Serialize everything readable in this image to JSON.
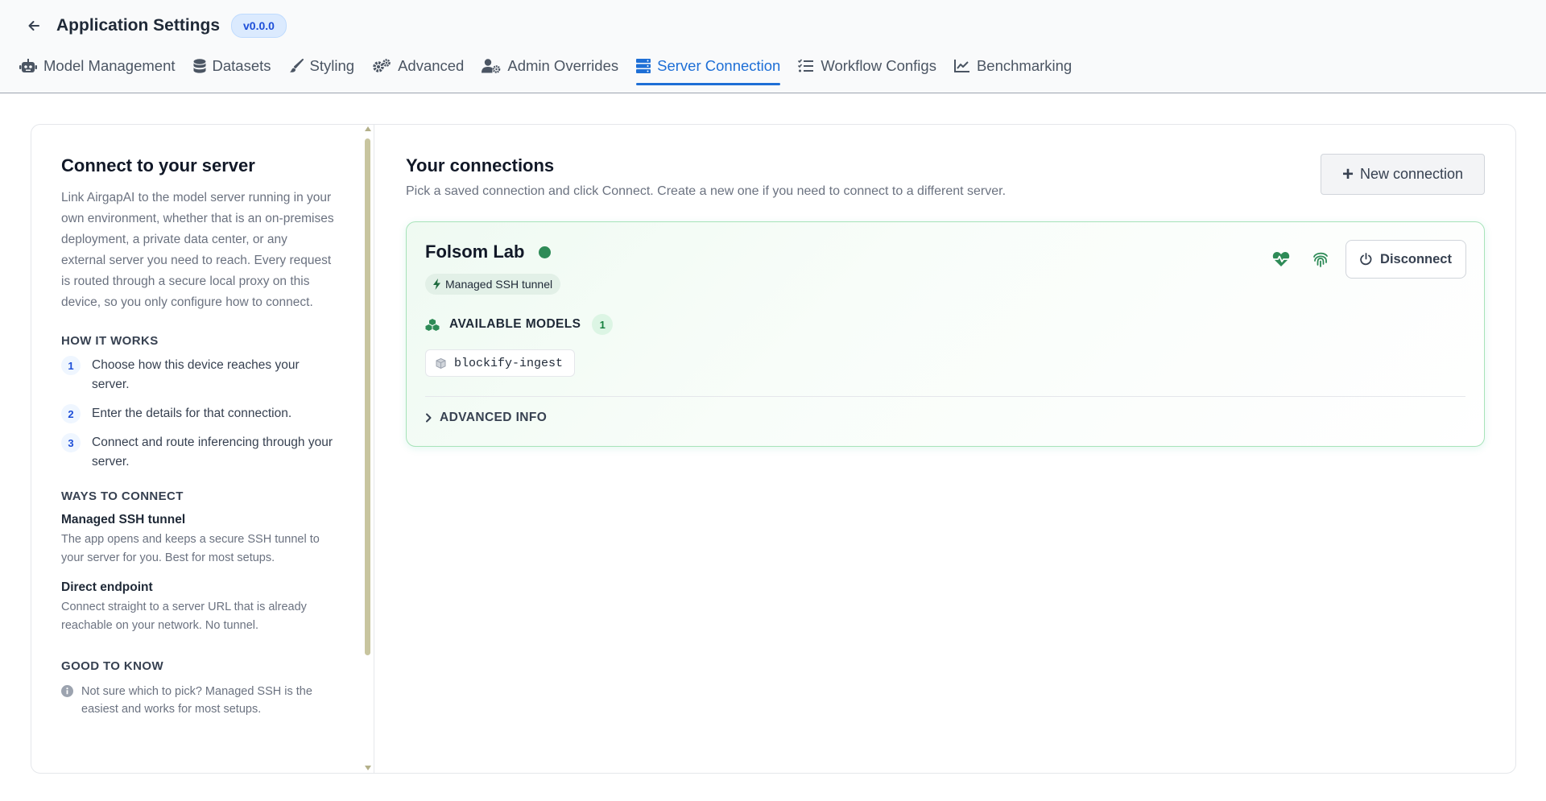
{
  "header": {
    "title": "Application Settings",
    "version": "v0.0.0"
  },
  "tabs": [
    {
      "label": "Model Management",
      "icon": "robot-icon",
      "active": false
    },
    {
      "label": "Datasets",
      "icon": "database-icon",
      "active": false
    },
    {
      "label": "Styling",
      "icon": "brush-icon",
      "active": false
    },
    {
      "label": "Advanced",
      "icon": "gears-icon",
      "active": false
    },
    {
      "label": "Admin Overrides",
      "icon": "user-gear-icon",
      "active": false
    },
    {
      "label": "Server Connection",
      "icon": "server-icon",
      "active": true
    },
    {
      "label": "Workflow Configs",
      "icon": "list-check-icon",
      "active": false
    },
    {
      "label": "Benchmarking",
      "icon": "chart-line-icon",
      "active": false
    }
  ],
  "sidebar": {
    "title": "Connect to your server",
    "description": "Link AirgapAI to the model server running in your own environment, whether that is an on-premises deployment, a private data center, or any external server you need to reach. Every request is routed through a secure local proxy on this device, so you only configure how to connect.",
    "how_it_works": {
      "heading": "HOW IT WORKS",
      "steps": [
        {
          "num": "1",
          "text": "Choose how this device reaches your server."
        },
        {
          "num": "2",
          "text": "Enter the details for that connection."
        },
        {
          "num": "3",
          "text": "Connect and route inferencing through your server."
        }
      ]
    },
    "ways": {
      "heading": "WAYS TO CONNECT",
      "items": [
        {
          "title": "Managed SSH tunnel",
          "desc": "The app opens and keeps a secure SSH tunnel to your server for you. Best for most setups."
        },
        {
          "title": "Direct endpoint",
          "desc": "Connect straight to a server URL that is already reachable on your network. No tunnel."
        }
      ]
    },
    "good_to_know": {
      "heading": "GOOD TO KNOW",
      "tip": "Not sure which to pick? Managed SSH is the easiest and works for most setups."
    }
  },
  "main": {
    "title": "Your connections",
    "subtitle": "Pick a saved connection and click Connect. Create a new one if you need to connect to a different server.",
    "new_button": "New connection",
    "connection": {
      "name": "Folsom Lab",
      "status_color": "#2e8b57",
      "type_badge": "Managed SSH tunnel",
      "models_label": "AVAILABLE MODELS",
      "models_count": "1",
      "models": [
        "blockify-ingest"
      ],
      "advanced_label": "ADVANCED INFO",
      "disconnect_label": "Disconnect"
    }
  },
  "colors": {
    "accent": "#1e6fd6",
    "success": "#2e8b57"
  }
}
